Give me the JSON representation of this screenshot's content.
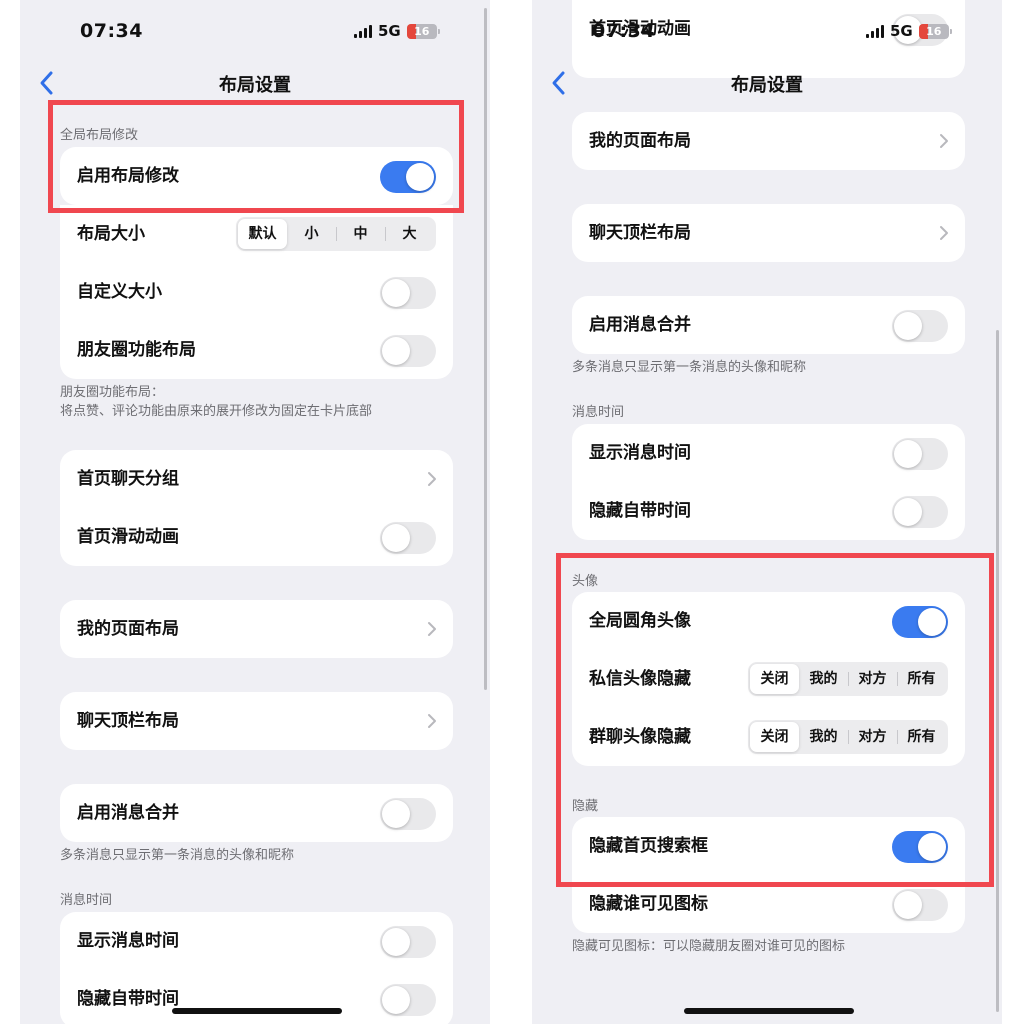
{
  "left": {
    "status": {
      "time": "07:34",
      "network": "5G",
      "battery": "16"
    },
    "nav": {
      "title": "布局设置"
    },
    "global_section": {
      "label": "全局布局修改",
      "enable_label": "启用布局修改",
      "enable_on": true
    },
    "layout_card": {
      "size_label": "布局大小",
      "size_options": [
        "默认",
        "小",
        "中",
        "大"
      ],
      "size_selected": "默认",
      "custom_size_label": "自定义大小",
      "custom_size_on": false,
      "moments_label": "朋友圈功能布局",
      "moments_on": false
    },
    "moments_note": [
      "朋友圈功能布局：",
      "将点赞、评论功能由原来的展开修改为固定在卡片底部"
    ],
    "home_card": {
      "chat_group_label": "首页聊天分组",
      "scroll_anim_label": "首页滑动动画",
      "scroll_anim_on": false
    },
    "my_page_label": "我的页面布局",
    "chat_topbar_label": "聊天顶栏布局",
    "merge_card": {
      "label": "启用消息合并",
      "on": false
    },
    "merge_note": "多条消息只显示第一条消息的头像和昵称",
    "time_section": {
      "label": "消息时间",
      "show_time_label": "显示消息时间",
      "show_time_on": false,
      "hide_builtin_label": "隐藏自带时间",
      "hide_builtin_on": false
    }
  },
  "right": {
    "status": {
      "time": "07:34",
      "network": "5G",
      "battery": "16"
    },
    "nav": {
      "title": "布局设置"
    },
    "partial_top_label": "首页滑动动画",
    "my_page_label": "我的页面布局",
    "chat_topbar_label": "聊天顶栏布局",
    "merge_card": {
      "label": "启用消息合并",
      "on": false
    },
    "merge_note": "多条消息只显示第一条消息的头像和昵称",
    "time_section": {
      "label": "消息时间",
      "show_time_label": "显示消息时间",
      "show_time_on": false,
      "hide_builtin_label": "隐藏自带时间",
      "hide_builtin_on": false
    },
    "avatar_section": {
      "label": "头像",
      "round_avatar_label": "全局圆角头像",
      "round_avatar_on": true,
      "dm_avatar_label": "私信头像隐藏",
      "dm_options": [
        "关闭",
        "我的",
        "对方",
        "所有"
      ],
      "dm_selected": "关闭",
      "group_avatar_label": "群聊头像隐藏",
      "group_options": [
        "关闭",
        "我的",
        "对方",
        "所有"
      ],
      "group_selected": "关闭"
    },
    "hide_section": {
      "label": "隐藏",
      "search_label": "隐藏首页搜索框",
      "search_on": true,
      "visibility_icon_label": "隐藏谁可见图标",
      "visibility_icon_on": false
    },
    "hide_note": "隐藏可见图标：可以隐藏朋友圈对谁可见的图标"
  },
  "colors": {
    "accent": "#3a7bf0",
    "highlight": "#f0474f",
    "battery_low": "#e4473c",
    "background": "#efeff4"
  }
}
